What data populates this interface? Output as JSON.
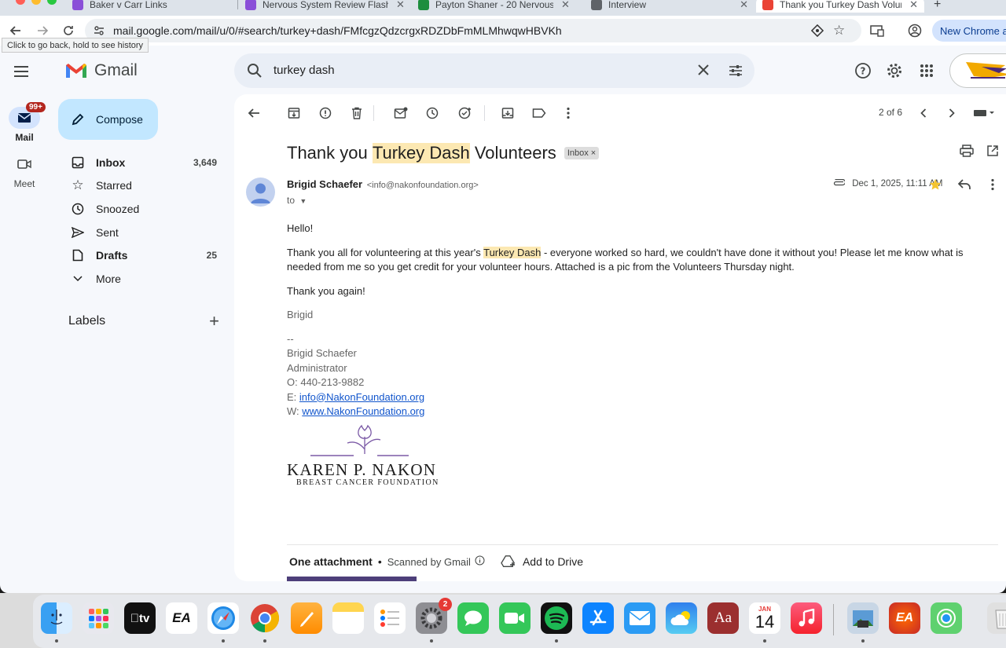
{
  "browser": {
    "tabs": [
      {
        "title": "Baker v Carr Links"
      },
      {
        "title": "Nervous System Review Flash"
      },
      {
        "title": "Payton Shaner - 20 Nervous"
      },
      {
        "title": "Interview"
      },
      {
        "title": "Thank you Turkey Dash Volunte"
      }
    ],
    "url": "mail.google.com/mail/u/0/#search/turkey+dash/FMfcgzQdzcrgxRDZDbFmMLMhwqwHBVKh",
    "tooltip": "Click to go back, hold to see history",
    "new_chrome_label": "New Chrome av"
  },
  "gmail": {
    "brand": "Gmail",
    "rail": {
      "mail_label": "Mail",
      "mail_badge": "99+",
      "meet_label": "Meet"
    },
    "search_query": "turkey dash",
    "compose_label": "Compose",
    "nav": [
      {
        "label": "Inbox",
        "count": "3,649",
        "icon": "inbox-icon",
        "bold": true
      },
      {
        "label": "Starred",
        "count": "",
        "icon": "star-icon",
        "bold": false
      },
      {
        "label": "Snoozed",
        "count": "",
        "icon": "clock-icon",
        "bold": false
      },
      {
        "label": "Sent",
        "count": "",
        "icon": "send-icon",
        "bold": false
      },
      {
        "label": "Drafts",
        "count": "25",
        "icon": "draft-icon",
        "bold": true
      },
      {
        "label": "More",
        "count": "",
        "icon": "chevron-down-icon",
        "bold": false
      }
    ],
    "labels_heading": "Labels",
    "pager": "2 of 6"
  },
  "message": {
    "subject_pre": "Thank you ",
    "subject_highlight": "Turkey Dash",
    "subject_post": " Volunteers",
    "inbox_chip": "Inbox",
    "sender_name": "Brigid Schaefer",
    "sender_email": "<info@nakonfoundation.org>",
    "to_label": "to",
    "date": "Dec 1, 2025, 11:11 AM",
    "greeting": "Hello!",
    "body_pre": "Thank you all for volunteering at this year's ",
    "body_highlight": "Turkey Dash",
    "body_post": " - everyone worked so hard, we couldn't have done it without you! Please let me know what is needed from me so you get credit for your volunteer hours. Attached is a pic from the Volunteers Thursday night.",
    "thanks": "Thank you again!",
    "signoff": "Brigid",
    "sig_dash": "--",
    "sig_name": "Brigid Schaefer",
    "sig_title": "Administrator",
    "sig_phone": "O: 440-213-9882",
    "sig_email_prefix": "E: ",
    "sig_email": "info@NakonFoundation.org",
    "sig_web_prefix": "W: ",
    "sig_web": "www.NakonFoundation.org",
    "logo_line1": "KAREN P. NAKON",
    "logo_line2": "BREAST CANCER FOUNDATION",
    "attachments_label": "One attachment",
    "scanned_label": "Scanned by Gmail",
    "add_to_drive": "Add to Drive"
  },
  "dock": {
    "apps": [
      "finder-icon",
      "launchpad-icon",
      "apple-tv-icon",
      "ea-icon",
      "safari-icon",
      "chrome-icon",
      "pages-icon",
      "notes-icon",
      "reminders-icon",
      "system-settings-icon",
      "messages-icon",
      "facetime-icon",
      "spotify-icon",
      "app-store-icon",
      "mail-icon",
      "weather-icon",
      "dictionary-icon",
      "calendar-icon",
      "music-icon",
      "preview-icon",
      "ea-app-icon",
      "find-my-icon"
    ],
    "settings_badge": "2",
    "calendar_month": "JAN",
    "calendar_day": "14",
    "apple_tv_label": "tv",
    "ea_label": "EA",
    "dictionary_label": "Aa"
  }
}
